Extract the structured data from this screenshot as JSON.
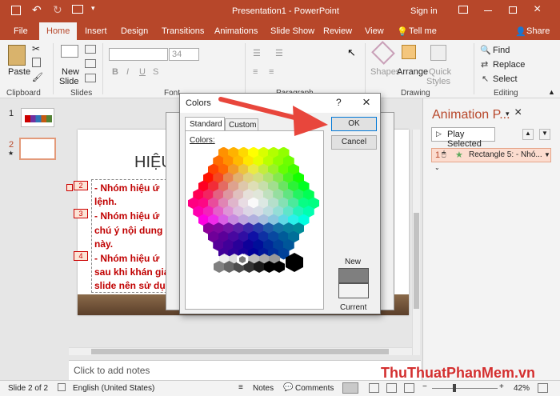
{
  "app": {
    "title": "Presentation1 - PowerPoint",
    "sign_in": "Sign in",
    "accent": "#b7472a"
  },
  "tabs": [
    "File",
    "Home",
    "Insert",
    "Design",
    "Transitions",
    "Animations",
    "Slide Show",
    "Review",
    "View"
  ],
  "tell_me": "Tell me",
  "share": "Share",
  "ribbon": {
    "paste": "Paste",
    "clipboard": "Clipboard",
    "new_slide": "New",
    "new_slide_2": "Slide",
    "slides": "Slides",
    "font_size": "34",
    "font_group": "Font",
    "paragraph": "Paragraph",
    "shapes": "Shapes",
    "arrange": "Arrange",
    "quick_styles_1": "Quick",
    "quick_styles_2": "Styles",
    "drawing": "Drawing",
    "find": "Find",
    "replace": "Replace",
    "select": "Select",
    "editing": "Editing"
  },
  "thumbs": [
    "1",
    "2"
  ],
  "slide": {
    "title": "HIỆU",
    "markers": [
      "2",
      "3",
      "4"
    ],
    "lines": [
      "- Nhóm hiệu ứ",
      "lệnh.",
      "- Nhóm hiệu ứ",
      "chú ý nội dung",
      "này.",
      "- Nhóm hiệu ứ",
      "sau khi khán giả",
      "slide nên sử dụ"
    ]
  },
  "notes_placeholder": "Click to add notes",
  "status": {
    "slide": "Slide 2 of 2",
    "language": "English (United States)",
    "notes": "Notes",
    "comments": "Comments",
    "zoom": "42%"
  },
  "animation_pane": {
    "title": "Animation P...",
    "play": "Play Selected",
    "item": "Rectangle 5: - Nhó..."
  },
  "dialog": {
    "title": "Colors",
    "help": "?",
    "close": "×",
    "tab_standard": "Standard",
    "tab_custom": "Custom",
    "colors_label": "Colors:",
    "ok": "OK",
    "cancel": "Cancel",
    "new": "New",
    "current": "Current",
    "new_color": "#7f7f7f",
    "current_color": "#f2f2f2"
  },
  "watermark": "ThuThuatPhanMem.vn"
}
